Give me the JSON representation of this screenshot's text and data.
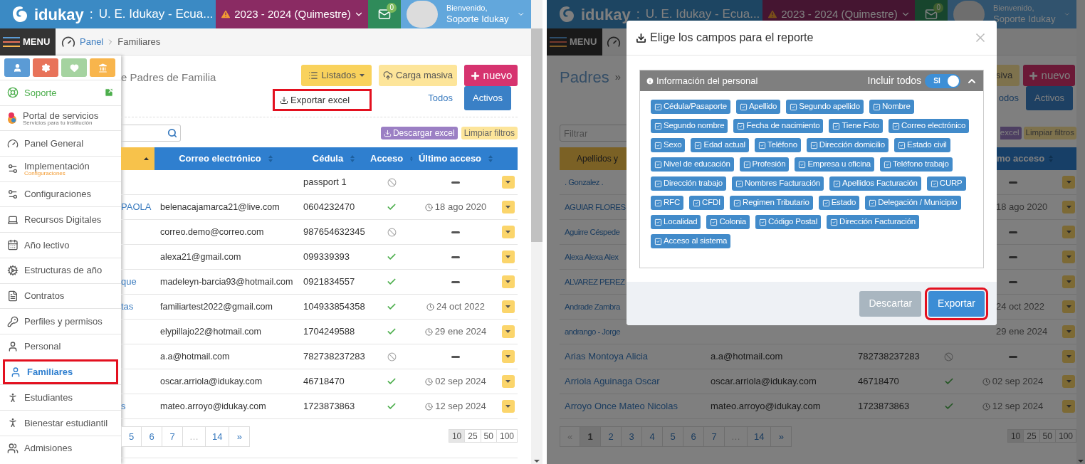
{
  "left_panel": {
    "top_bar": {
      "brand": "idukay",
      "separator": ":",
      "institution": "U. E. Idukay - Ecua...",
      "period": "2023 - 2024 (Quimestre)",
      "unread": "0",
      "greeting": "Bienvenido,",
      "user": "Soporte Idukay"
    },
    "nav_bar": {
      "menu_label": "MENU",
      "breadcrumb": [
        "Panel",
        "Familiares"
      ]
    },
    "menu": {
      "shortcuts": [
        {
          "color": "#5b9bd5"
        },
        {
          "color": "#e8735a"
        },
        {
          "color": "#a5d3a0"
        },
        {
          "color": "#f8b54c"
        }
      ],
      "items": [
        {
          "label": "Soporte",
          "kind": "external",
          "selected": false,
          "highlighted": false
        },
        {
          "label": "Portal de servicios",
          "subtitle": "Servicios para tu institución",
          "kind": "normal",
          "selected": false,
          "highlighted": false
        },
        {
          "label": "Panel General",
          "kind": "normal",
          "selected": false,
          "highlighted": false
        },
        {
          "label": "Implementación",
          "subtitle": "Configuraciones",
          "kind": "normal",
          "selected": false,
          "highlighted": false
        },
        {
          "label": "Configuraciones",
          "kind": "normal",
          "selected": false,
          "highlighted": false
        },
        {
          "label": "Recursos Digitales",
          "kind": "normal",
          "selected": false,
          "highlighted": false
        },
        {
          "label": "Año lectivo",
          "kind": "normal",
          "selected": false,
          "highlighted": false
        },
        {
          "label": "Estructuras de año",
          "kind": "normal",
          "selected": false,
          "highlighted": false
        },
        {
          "label": "Contratos",
          "kind": "normal",
          "selected": false,
          "highlighted": false
        },
        {
          "label": "Perfiles y permisos",
          "kind": "normal",
          "selected": false,
          "highlighted": false
        },
        {
          "label": "Personal",
          "kind": "normal",
          "selected": false,
          "highlighted": false
        },
        {
          "label": "Familiares",
          "kind": "normal",
          "selected": true,
          "highlighted": true
        },
        {
          "label": "Estudiantes",
          "kind": "normal",
          "selected": false,
          "highlighted": false
        },
        {
          "label": "Bienestar estudiantil",
          "kind": "normal",
          "selected": false,
          "highlighted": false
        },
        {
          "label": "Admisiones",
          "kind": "normal",
          "selected": false,
          "highlighted": false
        }
      ]
    },
    "toolbar": {
      "title": "e Padres de Familia",
      "list_button": "Listados",
      "upload_button": "Carga masiva",
      "new_button": "nuevo",
      "dropdown_item": {
        "label": "Exportar excel",
        "highlighted": true
      },
      "filters": [
        {
          "label": "Todos",
          "selected": false
        },
        {
          "label": "Activos",
          "selected": true
        }
      ],
      "download_button": "Descargar excel",
      "clear_button": "Limpiar filtros"
    },
    "table": {
      "columns": [
        "Correo electrónico",
        "Cédula",
        "Acceso",
        "Último acceso"
      ],
      "rows": [
        {
          "id_number": "passport 1",
          "access": false
        },
        {
          "name": "PAOLA",
          "email": "belenacajamarca21@live.com",
          "id_number": "0604232470",
          "access": true,
          "last_access": "18 ago 2020"
        },
        {
          "email": "correo.demo@correo.com",
          "id_number": "987654632345",
          "access": false
        },
        {
          "email": "alexa21@gmail.com",
          "id_number": "099339393",
          "access": true
        },
        {
          "name": "que",
          "email": "madeleyn-barcia93@hotmail.com",
          "id_number": "0921834557",
          "access": true
        },
        {
          "name": "tas",
          "email": "familiartest2022@gmail.com",
          "id_number": "104933854358",
          "access": true,
          "last_access": "24 oct 2022"
        },
        {
          "email": "elypillajo22@hotmail.com",
          "id_number": "1704249588",
          "access": true,
          "last_access": "29 ene 2024"
        },
        {
          "email": "a.a@hotmail.com",
          "id_number": "782738237283",
          "access": false
        },
        {
          "email": "oscar.arriola@idukay.com",
          "id_number": "46718470",
          "access": true,
          "last_access": "02 sep 2024"
        },
        {
          "name": "s",
          "email": "mateo.arroyo@idukay.com",
          "id_number": "1723873863",
          "access": true,
          "last_access": "12 sep 2024"
        }
      ]
    },
    "pagination": {
      "pages": [
        {
          "label": "5",
          "selected": false,
          "disabled": false
        },
        {
          "label": "6",
          "selected": false,
          "disabled": false
        },
        {
          "label": "7",
          "selected": false,
          "disabled": false
        },
        {
          "label": "…",
          "selected": false,
          "disabled": true
        },
        {
          "label": "14",
          "selected": false,
          "disabled": false
        },
        {
          "label": "»",
          "selected": false,
          "disabled": false
        }
      ],
      "page_sizes": [
        {
          "label": "10",
          "selected": true
        },
        {
          "label": "25",
          "selected": false
        },
        {
          "label": "50",
          "selected": false
        },
        {
          "label": "100",
          "selected": false
        }
      ]
    }
  },
  "right_panel": {
    "top_bar": {
      "brand": "idukay",
      "separator": ":",
      "institution": "U. E. Idukay - Ecua...",
      "period": "2023 - 2024 (Quimestre)",
      "unread": "0",
      "greeting": "Bienvenido,",
      "user": "Soporte Idukay"
    },
    "nav_bar": {
      "menu_label": "MENU"
    },
    "toolbar": {
      "title": "Padres",
      "title_separator": "»",
      "upload_button": "siva",
      "new_button": "nuevo",
      "filters": [
        {
          "label": "odos",
          "selected": false
        },
        {
          "label": "Activos",
          "selected": true
        }
      ],
      "filter_placeholder": "Filtrar",
      "download_button": "excel",
      "clear_button": "Limpiar filtros"
    },
    "table": {
      "columns": [
        "Apellidos y",
        "mo acceso"
      ],
      "rows": [
        {
          "kind": "partial",
          "name": ". Gonzalez ."
        },
        {
          "kind": "partial",
          "name": "AGUIAR FLORES",
          "last_access": "18 ago 2020"
        },
        {
          "kind": "partial",
          "name": "Aguirre Céspede"
        },
        {
          "kind": "partial",
          "name": "Alexa Alexa Alex"
        },
        {
          "kind": "partial",
          "name": "ALVAREZ PEREZ"
        },
        {
          "kind": "partial",
          "name": "Andrade Zambra",
          "last_access": "24 oct 2022"
        },
        {
          "kind": "partial",
          "name": "andrango - Jorge",
          "last_access": "29 ene 2024"
        },
        {
          "kind": "full",
          "name": "Arias Montoya Alicia",
          "email": "a.a@hotmail.com",
          "id_number": "782738237283",
          "access": false
        },
        {
          "kind": "full",
          "name": "Arriola Aguinaga Oscar",
          "email": "oscar.arriola@idukay.com",
          "id_number": "46718470",
          "access": true,
          "last_access": "02 sep 2024"
        },
        {
          "kind": "full",
          "name": "Arroyo Once Mateo Nicolas",
          "email": "mateo.arroyo@idukay.com",
          "id_number": "1723873863",
          "access": true,
          "last_access": "12 sep 2024"
        }
      ]
    },
    "pagination": {
      "pages": [
        {
          "label": "«",
          "selected": false,
          "disabled": true
        },
        {
          "label": "1",
          "selected": true,
          "disabled": false
        },
        {
          "label": "2",
          "selected": false,
          "disabled": false
        },
        {
          "label": "3",
          "selected": false,
          "disabled": false
        },
        {
          "label": "4",
          "selected": false,
          "disabled": false
        },
        {
          "label": "5",
          "selected": false,
          "disabled": false
        },
        {
          "label": "6",
          "selected": false,
          "disabled": false
        },
        {
          "label": "7",
          "selected": false,
          "disabled": false
        },
        {
          "label": "…",
          "selected": false,
          "disabled": true
        },
        {
          "label": "14",
          "selected": false,
          "disabled": false
        },
        {
          "label": "»",
          "selected": false,
          "disabled": false
        }
      ],
      "page_sizes": [
        {
          "label": "10",
          "selected": true
        },
        {
          "label": "25",
          "selected": false
        },
        {
          "label": "50",
          "selected": false
        },
        {
          "label": "100",
          "selected": false
        }
      ]
    },
    "modal": {
      "title": "Elige los campos para el reporte",
      "section": {
        "title": "Información del personal",
        "include_all_label": "Incluir todos",
        "include_all": {
          "label": "SI",
          "on": true
        },
        "expanded": true,
        "fields": [
          {
            "label": "Cédula/Pasaporte",
            "checked": true
          },
          {
            "label": "Apellido",
            "checked": true
          },
          {
            "label": "Segundo apellido",
            "checked": true
          },
          {
            "label": "Nombre",
            "checked": true
          },
          {
            "label": "Segundo nombre",
            "checked": true
          },
          {
            "label": "Fecha de nacimiento",
            "checked": true
          },
          {
            "label": "Tiene Foto",
            "checked": true
          },
          {
            "label": "Correo electrónico",
            "checked": true
          },
          {
            "label": "Sexo",
            "checked": true
          },
          {
            "label": "Edad actual",
            "checked": true
          },
          {
            "label": "Teléfono",
            "checked": true
          },
          {
            "label": "Dirección domicilio",
            "checked": true
          },
          {
            "label": "Estado civil",
            "checked": true
          },
          {
            "label": "Nivel de educación",
            "checked": true
          },
          {
            "label": "Profesión",
            "checked": true
          },
          {
            "label": "Empresa u oficina",
            "checked": true
          },
          {
            "label": "Teléfono trabajo",
            "checked": true
          },
          {
            "label": "Dirección trabajo",
            "checked": true
          },
          {
            "label": "Nombres Facturación",
            "checked": true
          },
          {
            "label": "Apellidos Facturación",
            "checked": true
          },
          {
            "label": "CURP",
            "checked": true
          },
          {
            "label": "RFC",
            "checked": true
          },
          {
            "label": "CFDI",
            "checked": true
          },
          {
            "label": "Regimen Tributario",
            "checked": true
          },
          {
            "label": "Estado",
            "checked": true
          },
          {
            "label": "Delegación / Municipio",
            "checked": true
          },
          {
            "label": "Localidad",
            "checked": true
          },
          {
            "label": "Colonia",
            "checked": true
          },
          {
            "label": "Código Postal",
            "checked": true
          },
          {
            "label": "Dirección Facturación",
            "checked": true
          },
          {
            "label": "Acceso al sistema",
            "checked": true
          }
        ]
      },
      "buttons": [
        {
          "label": "Descartar",
          "kind": "secondary",
          "highlighted": false
        },
        {
          "label": "Exportar",
          "kind": "primary",
          "highlighted": true
        }
      ]
    }
  }
}
